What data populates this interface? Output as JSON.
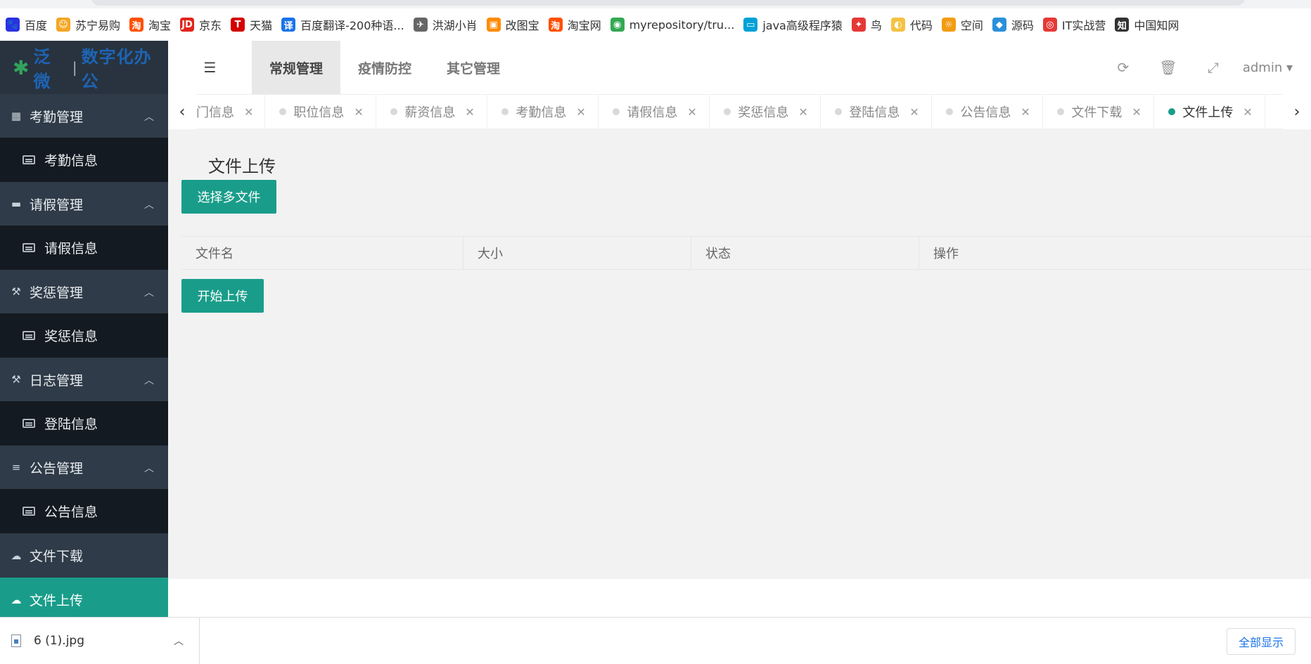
{
  "bookmarks": [
    {
      "label": "百度",
      "icon": "baidu-icon",
      "color": "#2932e1",
      "glyph": "🐾"
    },
    {
      "label": "苏宁易购",
      "icon": "suning-icon",
      "color": "#f5a623",
      "glyph": "☺"
    },
    {
      "label": "淘宝",
      "icon": "taobao-icon",
      "color": "#ff5000",
      "glyph": "淘"
    },
    {
      "label": "京东",
      "icon": "jd-icon",
      "color": "#e1251b",
      "glyph": "JD"
    },
    {
      "label": "天猫",
      "icon": "tmall-icon",
      "color": "#d40000",
      "glyph": "T"
    },
    {
      "label": "百度翻译-200种语...",
      "icon": "fanyi-icon",
      "color": "#1a73e8",
      "glyph": "译"
    },
    {
      "label": "洪湖小肖",
      "icon": "bird-icon",
      "color": "#666666",
      "glyph": "✈"
    },
    {
      "label": "改图宝",
      "icon": "gaitu-icon",
      "color": "#ff8a00",
      "glyph": "▣"
    },
    {
      "label": "淘宝网",
      "icon": "taobao2-icon",
      "color": "#ff5000",
      "glyph": "淘"
    },
    {
      "label": "myrepository/tru...",
      "icon": "chrome-icon",
      "color": "#34a853",
      "glyph": "◉"
    },
    {
      "label": "java高级程序猿",
      "icon": "bilibili-icon",
      "color": "#00a1d6",
      "glyph": "▭"
    },
    {
      "label": "鸟",
      "icon": "niao-icon",
      "color": "#e53935",
      "glyph": "✦"
    },
    {
      "label": "代码",
      "icon": "code-icon",
      "color": "#f5c242",
      "glyph": "◐"
    },
    {
      "label": "空间",
      "icon": "qzone-icon",
      "color": "#f39c12",
      "glyph": "☼"
    },
    {
      "label": "源码",
      "icon": "yuanma-icon",
      "color": "#2b90d9",
      "glyph": "◆"
    },
    {
      "label": "IT实战营",
      "icon": "it-icon",
      "color": "#e53935",
      "glyph": "◎"
    },
    {
      "label": "中国知网",
      "icon": "cnki-icon",
      "color": "#333333",
      "glyph": "知"
    }
  ],
  "logo": {
    "mark": "✱",
    "brand": "泛微",
    "sep": "|",
    "product": "数字化办公"
  },
  "sidebar": {
    "groups": [
      {
        "label": "考勤管理",
        "icon": "calendar-icon",
        "glyph": "▦",
        "sub": "考勤信息"
      },
      {
        "label": "请假管理",
        "icon": "bed-icon",
        "glyph": "▬",
        "sub": "请假信息"
      },
      {
        "label": "奖惩管理",
        "icon": "gavel-icon",
        "glyph": "⚒",
        "sub": "奖惩信息"
      },
      {
        "label": "日志管理",
        "icon": "gavel-icon",
        "glyph": "⚒",
        "sub": "登陆信息"
      },
      {
        "label": "公告管理",
        "icon": "list-icon",
        "glyph": "≡",
        "sub": "公告信息"
      }
    ],
    "download": {
      "label": "文件下载",
      "icon": "cloud-download-icon",
      "glyph": "☁"
    },
    "upload": {
      "label": "文件上传",
      "icon": "cloud-upload-icon",
      "glyph": "☁"
    }
  },
  "header": {
    "nav": [
      "常规管理",
      "疫情防控",
      "其它管理"
    ],
    "user": "admin ▾"
  },
  "tabs": [
    {
      "label": "门信息",
      "partial": true
    },
    {
      "label": "职位信息"
    },
    {
      "label": "薪资信息"
    },
    {
      "label": "考勤信息"
    },
    {
      "label": "请假信息"
    },
    {
      "label": "奖惩信息"
    },
    {
      "label": "登陆信息"
    },
    {
      "label": "公告信息"
    },
    {
      "label": "文件下载"
    },
    {
      "label": "文件上传",
      "active": true
    }
  ],
  "content": {
    "title": "文件上传",
    "select_button": "选择多文件",
    "columns": [
      "文件名",
      "大小",
      "状态",
      "操作"
    ],
    "start_button": "开始上传"
  },
  "download_bar": {
    "file": "6 (1).jpg",
    "show_all": "全部显示"
  },
  "colors": {
    "accent": "#199d8a",
    "sidebar": "#2f3b48",
    "sidebar_sub": "#141a21"
  }
}
